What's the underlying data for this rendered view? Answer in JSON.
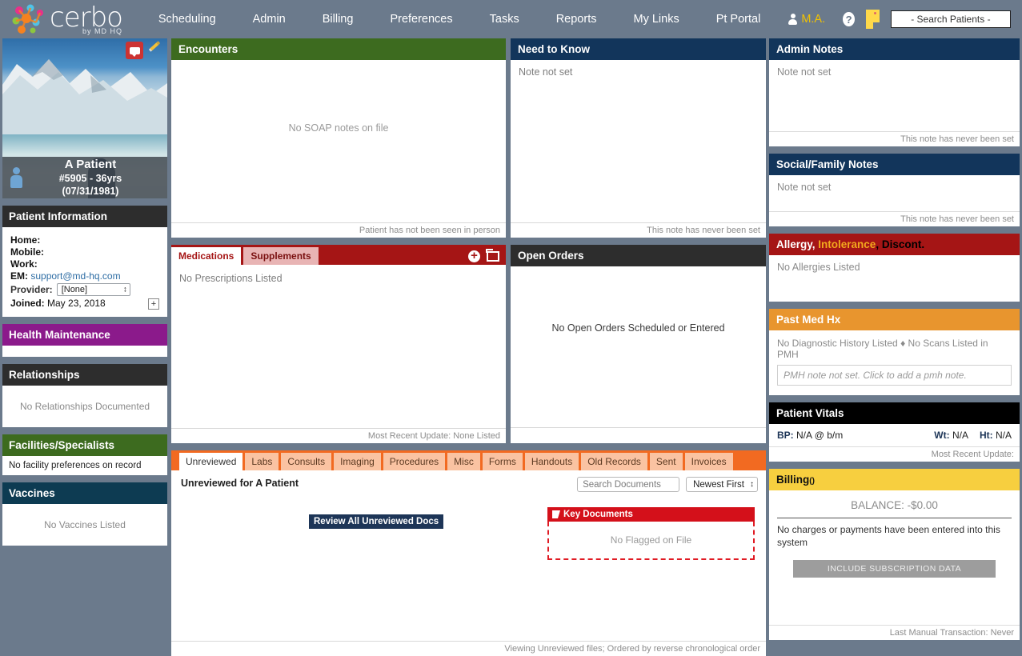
{
  "brand": {
    "name": "cerbo",
    "tagline": "by MD HQ"
  },
  "nav": {
    "items": [
      "Scheduling",
      "Admin",
      "Billing",
      "Preferences",
      "Tasks",
      "Reports",
      "My Links",
      "Pt Portal"
    ],
    "user": "M.A.",
    "help": "?",
    "search_placeholder": "- Search Patients -",
    "colors": {
      "bar": "#6b7a8c",
      "user_text": "#f2c200",
      "sticky": "#ffd94a"
    }
  },
  "patient": {
    "name": "A Patient",
    "id_line": "#5905 - 36yrs (07/31/1981)",
    "info_title": "Patient Information",
    "home_label": "Home:",
    "home_value": "",
    "mobile_label": "Mobile:",
    "mobile_value": "",
    "work_label": "Work:",
    "work_value": "",
    "email_label": "EM:",
    "email_value": "support@md-hq.com",
    "provider_label": "Provider:",
    "provider_value": "[None]",
    "joined_label": "Joined:",
    "joined_value": "May 23, 2018",
    "expand": "+"
  },
  "sidebar": {
    "health_maintenance": {
      "title": "Health Maintenance",
      "body": "",
      "color": "#8b1a8b"
    },
    "relationships": {
      "title": "Relationships",
      "body": "No Relationships Documented",
      "color": "#2d2d2d"
    },
    "facilities": {
      "title": "Facilities/Specialists",
      "body": "No facility preferences on record",
      "color": "#3d6b1f"
    },
    "vaccines": {
      "title": "Vaccines",
      "body": "No Vaccines Listed",
      "color": "#0d3b52"
    }
  },
  "encounters": {
    "title": "Encounters",
    "empty": "No SOAP notes on file",
    "footer": "Patient has not been seen in person",
    "color": "#3d6b1f"
  },
  "need_to_know": {
    "title": "Need to Know",
    "empty": "Note not set",
    "footer": "This note has never been set",
    "color": "#12355b"
  },
  "admin_notes": {
    "title": "Admin Notes",
    "empty": "Note not set",
    "footer": "This note has never been set",
    "color": "#12355b"
  },
  "social_family_notes": {
    "title": "Social/Family Notes",
    "empty": "Note not set",
    "footer": "This note has never been set",
    "color": "#12355b"
  },
  "medications": {
    "tab_medications": "Medications",
    "tab_supplements": "Supplements",
    "empty": "No Prescriptions Listed",
    "footer": "Most Recent Update: None Listed",
    "color": "#a51515"
  },
  "open_orders": {
    "title": "Open Orders",
    "empty": "No Open Orders Scheduled or Entered",
    "footer": "",
    "color": "#2d2d2d"
  },
  "allergy": {
    "title_a": "Allergy,",
    "title_b": "Intolerance",
    "title_c": ", Discont.",
    "empty": "No Allergies Listed",
    "color": "#a51515",
    "intolerance_color": "#f2a81d"
  },
  "past_med_hx": {
    "title": "Past Med Hx",
    "line": "No Diagnostic History Listed",
    "separator": "♦",
    "line2": "No Scans Listed in PMH",
    "note_placeholder": "PMH note not set. Click to add a pmh note.",
    "color": "#e8952e"
  },
  "vitals": {
    "title": "Patient Vitals",
    "bp_label": "BP:",
    "bp_value": "N/A @ b/m",
    "wt_label": "Wt:",
    "wt_value": "N/A",
    "ht_label": "Ht:",
    "ht_value": "N/A",
    "footer": "Most Recent Update:",
    "color": "#000000"
  },
  "billing": {
    "title": "Billing",
    "title_suffix": "()",
    "balance_label": "BALANCE:",
    "balance_value": "-$0.00",
    "message": "No charges or payments have been entered into this system",
    "button": "INCLUDE SUBSCRIPTION DATA",
    "footer": "Last Manual Transaction: Never",
    "color": "#f7cf3f"
  },
  "documents": {
    "tabs": [
      "Unreviewed",
      "Labs",
      "Consults",
      "Imaging",
      "Procedures",
      "Misc",
      "Forms",
      "Handouts",
      "Old Records",
      "Sent",
      "Invoices"
    ],
    "active_tab": "Unreviewed",
    "subtitle": "Unreviewed for A Patient",
    "search_placeholder": "Search Documents",
    "sort_value": "Newest First",
    "review_button": "Review All Unreviewed Docs",
    "key_documents_title": "Key Documents",
    "key_documents_empty": "No Flagged on File",
    "footer": "Viewing Unreviewed files; Ordered by reverse chronological order",
    "color": "#f26a21"
  }
}
